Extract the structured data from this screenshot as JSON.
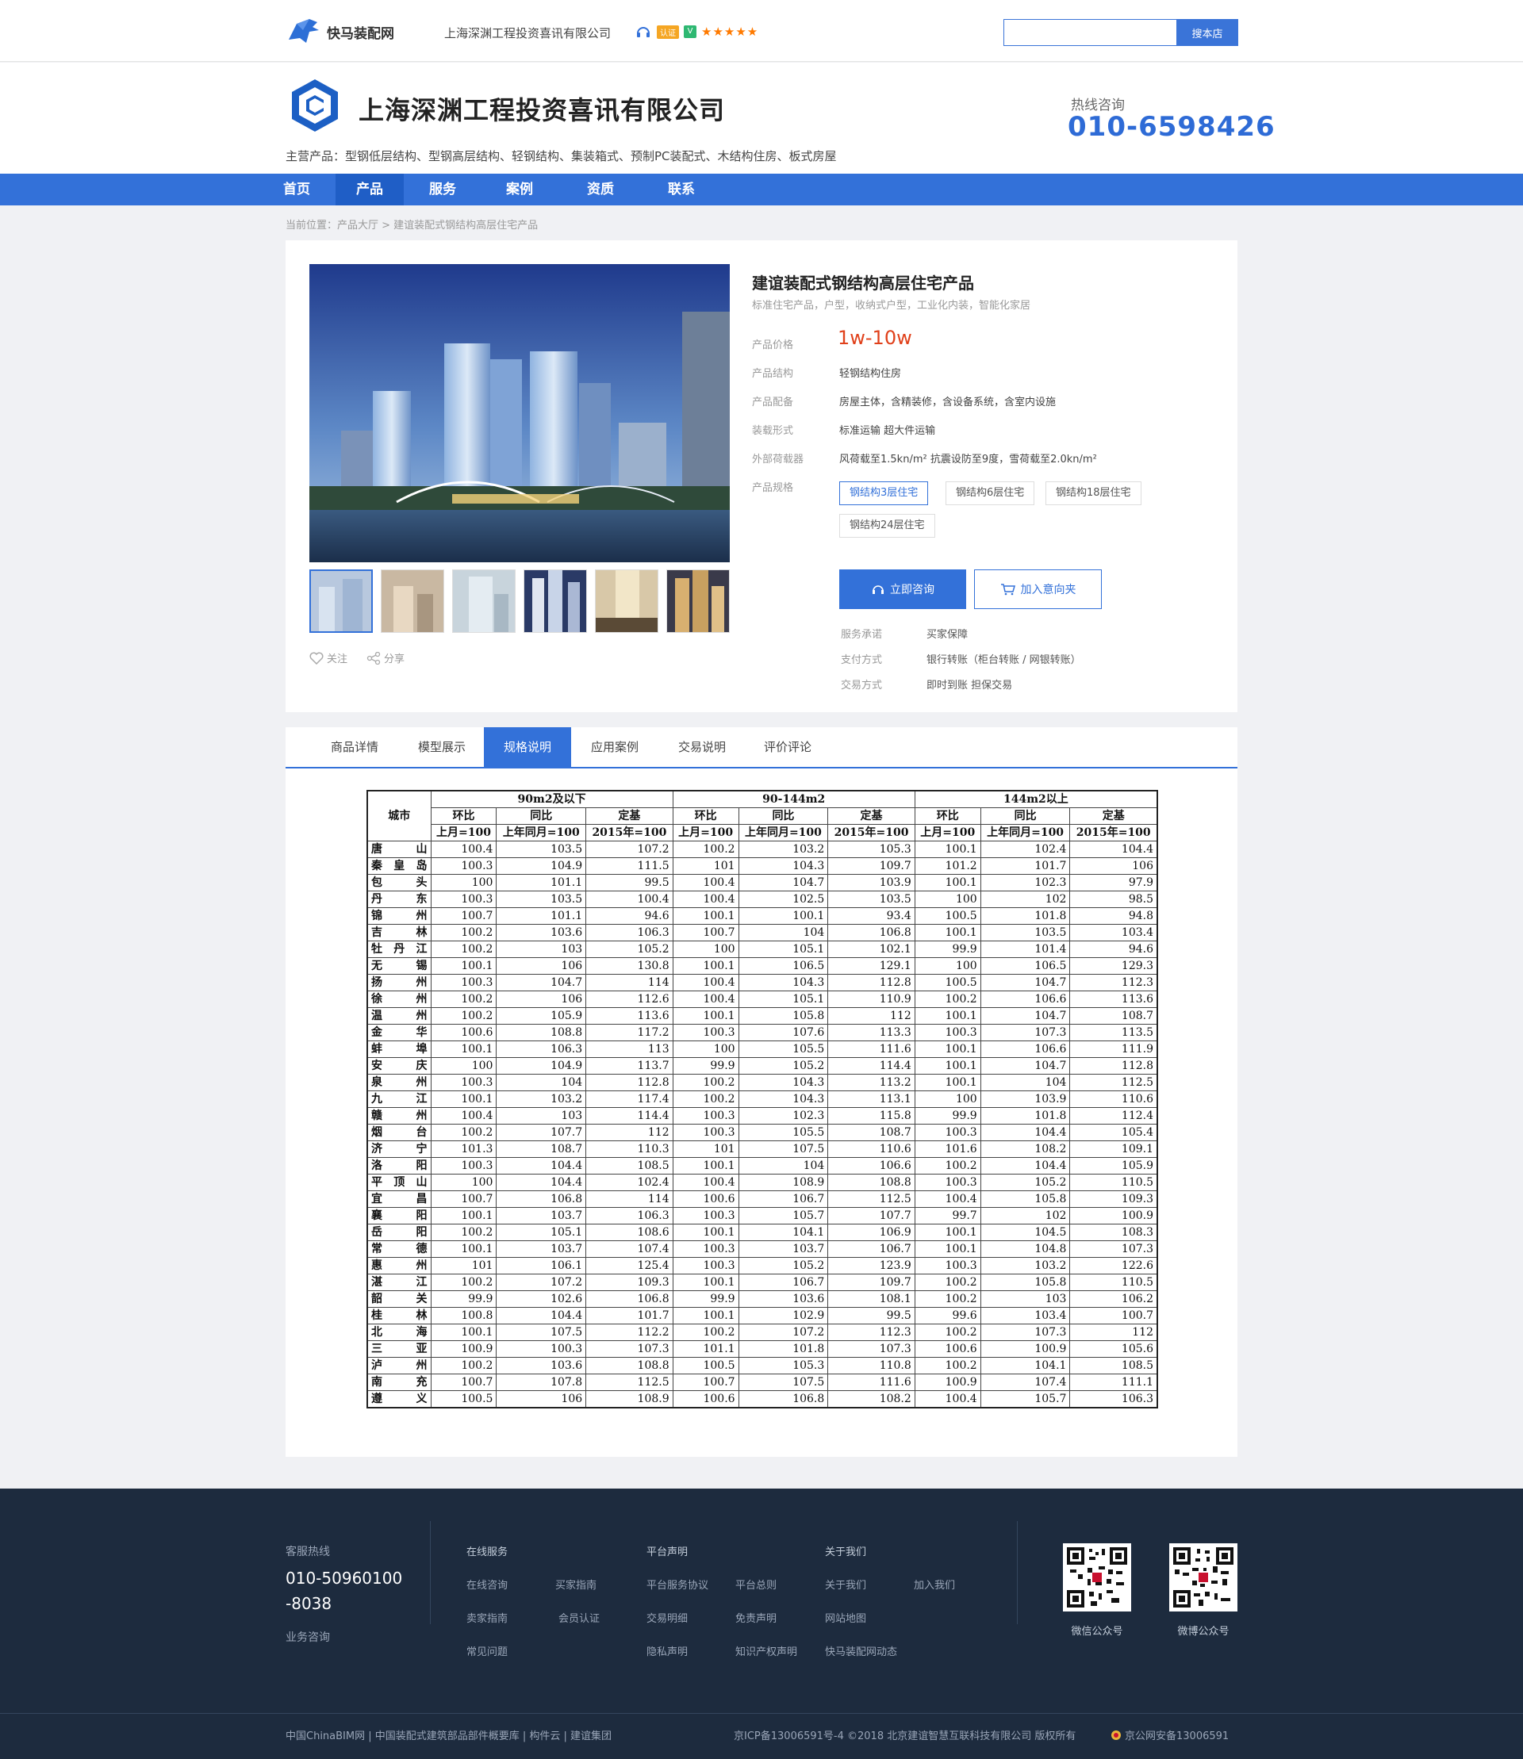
{
  "site": {
    "logo_text": "快马装配网",
    "top_company": "上海深渊工程投资喜讯有限公司",
    "cert_badge": "认证",
    "v_badge": "V",
    "stars": "★★★★★",
    "search_placeholder": "",
    "search_button": "搜本店"
  },
  "header": {
    "company_name": "上海深渊工程投资喜讯有限公司",
    "main_products": "主营产品：型钢低层结构、型钢高层结构、轻钢结构、集装箱式、预制PC装配式、木结构住房、板式房屋",
    "hotline_label": "热线咨询",
    "hotline_number": "010-6598426"
  },
  "nav": [
    "首页",
    "产品",
    "服务",
    "案例",
    "资质",
    "联系"
  ],
  "breadcrumb": "当前位置：产品大厅 > 建谊装配式钢结构高层住宅产品",
  "product": {
    "title": "建谊装配式钢结构高层住宅产品",
    "subtitle": "标准住宅产品，户型，收纳式户型，工业化内装，智能化家居",
    "follow": "关注",
    "share": "分享",
    "specs": [
      {
        "label": "产品价格",
        "value": ""
      },
      {
        "label": "产品结构",
        "value": "轻钢结构住房"
      },
      {
        "label": "产品配备",
        "value": "房屋主体，含精装修，含设备系统，含室内设施"
      },
      {
        "label": "装载形式",
        "value": "标准运输  超大件运输"
      },
      {
        "label": "外部荷载器",
        "value": "风荷载至1.5kn/m²  抗震设防至9度，雪荷载至2.0kn/m²"
      },
      {
        "label": "产品规格",
        "value": ""
      }
    ],
    "price": "1w-10w",
    "spec_options": [
      "钢结构3层住宅",
      "钢结构6层住宅",
      "钢结构18层住宅",
      "钢结构24层住宅"
    ],
    "btn_consult": "立即咨询",
    "btn_cart": "加入意向夹",
    "service": [
      {
        "label": "服务承诺",
        "value": "买家保障"
      },
      {
        "label": "支付方式",
        "value": "银行转账（柜台转账 / 网银转账）"
      },
      {
        "label": "交易方式",
        "value": "即时到账  担保交易"
      }
    ]
  },
  "tabs": [
    "商品详情",
    "模型展示",
    "规格说明",
    "应用案例",
    "交易说明",
    "评价评论"
  ],
  "table": {
    "city_header": "城市",
    "groups": [
      "90m2及以下",
      "90-144m2",
      "144m2以上"
    ],
    "subheads": [
      "环比",
      "同比",
      "定基"
    ],
    "bases": [
      "上月=100",
      "上年同月=100",
      "2015年=100"
    ],
    "rows": [
      [
        "唐山",
        "100.4",
        "103.5",
        "107.2",
        "100.2",
        "103.2",
        "105.3",
        "100.1",
        "102.4",
        "104.4"
      ],
      [
        "秦皇岛",
        "100.3",
        "104.9",
        "111.5",
        "101",
        "104.3",
        "109.7",
        "101.2",
        "101.7",
        "106"
      ],
      [
        "包头",
        "100",
        "101.1",
        "99.5",
        "100.4",
        "104.7",
        "103.9",
        "100.1",
        "102.3",
        "97.9"
      ],
      [
        "丹东",
        "100.3",
        "103.5",
        "100.4",
        "100.4",
        "102.5",
        "103.5",
        "100",
        "102",
        "98.5"
      ],
      [
        "锦州",
        "100.7",
        "101.1",
        "94.6",
        "100.1",
        "100.1",
        "93.4",
        "100.5",
        "101.8",
        "94.8"
      ],
      [
        "吉林",
        "100.2",
        "103.6",
        "106.3",
        "100.7",
        "104",
        "106.8",
        "100.1",
        "103.5",
        "103.4"
      ],
      [
        "牡丹江",
        "100.2",
        "103",
        "105.2",
        "100",
        "105.1",
        "102.1",
        "99.9",
        "101.4",
        "94.6"
      ],
      [
        "无锡",
        "100.1",
        "106",
        "130.8",
        "100.1",
        "106.5",
        "129.1",
        "100",
        "106.5",
        "129.3"
      ],
      [
        "扬州",
        "100.3",
        "104.7",
        "114",
        "100.4",
        "104.3",
        "112.8",
        "100.5",
        "104.7",
        "112.3"
      ],
      [
        "徐州",
        "100.2",
        "106",
        "112.6",
        "100.4",
        "105.1",
        "110.9",
        "100.2",
        "106.6",
        "113.6"
      ],
      [
        "温州",
        "100.2",
        "105.9",
        "113.6",
        "100.1",
        "105.8",
        "112",
        "100.1",
        "104.7",
        "108.7"
      ],
      [
        "金华",
        "100.6",
        "108.8",
        "117.2",
        "100.3",
        "107.6",
        "113.3",
        "100.3",
        "107.3",
        "113.5"
      ],
      [
        "蚌埠",
        "100.1",
        "106.3",
        "113",
        "100",
        "105.5",
        "111.6",
        "100.1",
        "106.6",
        "111.9"
      ],
      [
        "安庆",
        "100",
        "104.9",
        "113.7",
        "99.9",
        "105.2",
        "114.4",
        "100.1",
        "104.7",
        "112.8"
      ],
      [
        "泉州",
        "100.3",
        "104",
        "112.8",
        "100.2",
        "104.3",
        "113.2",
        "100.1",
        "104",
        "112.5"
      ],
      [
        "九江",
        "100.1",
        "103.2",
        "117.4",
        "100.2",
        "104.3",
        "113.1",
        "100",
        "103.9",
        "110.6"
      ],
      [
        "赣州",
        "100.4",
        "103",
        "114.4",
        "100.3",
        "102.3",
        "115.8",
        "99.9",
        "101.8",
        "112.4"
      ],
      [
        "烟台",
        "100.2",
        "107.7",
        "112",
        "100.3",
        "105.5",
        "108.7",
        "100.3",
        "104.4",
        "105.4"
      ],
      [
        "济宁",
        "101.3",
        "108.7",
        "110.3",
        "101",
        "107.5",
        "110.6",
        "101.6",
        "108.2",
        "109.1"
      ],
      [
        "洛阳",
        "100.3",
        "104.4",
        "108.5",
        "100.1",
        "104",
        "106.6",
        "100.2",
        "104.4",
        "105.9"
      ],
      [
        "平顶山",
        "100",
        "104.4",
        "102.4",
        "100.4",
        "108.9",
        "108.8",
        "100.3",
        "105.2",
        "110.5"
      ],
      [
        "宜昌",
        "100.7",
        "106.8",
        "114",
        "100.6",
        "106.7",
        "112.5",
        "100.4",
        "105.8",
        "109.3"
      ],
      [
        "襄阳",
        "100.1",
        "103.7",
        "106.3",
        "100.3",
        "105.7",
        "107.7",
        "99.7",
        "102",
        "100.9"
      ],
      [
        "岳阳",
        "100.2",
        "105.1",
        "108.6",
        "100.1",
        "104.1",
        "106.9",
        "100.1",
        "104.5",
        "108.3"
      ],
      [
        "常德",
        "100.1",
        "103.7",
        "107.4",
        "100.3",
        "103.7",
        "106.7",
        "100.1",
        "104.8",
        "107.3"
      ],
      [
        "惠州",
        "101",
        "106.1",
        "125.4",
        "100.3",
        "105.2",
        "123.9",
        "100.3",
        "103.2",
        "122.6"
      ],
      [
        "湛江",
        "100.2",
        "107.2",
        "109.3",
        "100.1",
        "106.7",
        "109.7",
        "100.2",
        "105.8",
        "110.5"
      ],
      [
        "韶关",
        "99.9",
        "102.6",
        "106.8",
        "99.9",
        "103.6",
        "108.1",
        "100.2",
        "103",
        "106.2"
      ],
      [
        "桂林",
        "100.8",
        "104.4",
        "101.7",
        "100.1",
        "102.9",
        "99.5",
        "99.6",
        "103.4",
        "100.7"
      ],
      [
        "北海",
        "100.1",
        "107.5",
        "112.2",
        "100.2",
        "107.2",
        "112.3",
        "100.2",
        "107.3",
        "112"
      ],
      [
        "三亚",
        "100.9",
        "100.3",
        "107.3",
        "101.1",
        "101.8",
        "107.3",
        "100.6",
        "100.9",
        "105.6"
      ],
      [
        "泸州",
        "100.2",
        "103.6",
        "108.8",
        "100.5",
        "105.3",
        "110.8",
        "100.2",
        "104.1",
        "108.5"
      ],
      [
        "南充",
        "100.7",
        "107.8",
        "112.5",
        "100.7",
        "107.5",
        "111.6",
        "100.9",
        "107.4",
        "111.1"
      ],
      [
        "遵义",
        "100.5",
        "106",
        "108.9",
        "100.6",
        "106.8",
        "108.2",
        "100.4",
        "105.7",
        "106.3"
      ]
    ]
  },
  "footer": {
    "service_label": "客服热线",
    "hotline_1": "010-50960100",
    "hotline_2": "-8038",
    "business": "业务咨询",
    "col_heads": [
      "在线服务",
      "平台声明",
      "关于我们"
    ],
    "links": [
      [
        "在线咨询",
        "买家指南",
        "卖家指南",
        "会员认证",
        "常见问题"
      ],
      [
        "平台服务协议",
        "平台总则",
        "交易明细",
        "免责声明",
        "隐私声明",
        "知识产权声明"
      ],
      [
        "关于我们",
        "加入我们",
        "网站地图",
        "快马装配网动态"
      ]
    ],
    "qr_labels": [
      "微信公众号",
      "微博公众号"
    ],
    "bottom_left": "中国ChinaBIM网 | 中国装配式建筑部品部件概要库 | 构件云 | 建谊集团",
    "bottom_right": "京ICP备13006591号-4  ©2018 北京建谊智慧互联科技有限公司 版权所有",
    "bottom_police": "京公网安备13006591"
  },
  "colors": {
    "primary": "#3371d9",
    "price": "#e0401a",
    "footer": "#1d2b3e"
  }
}
